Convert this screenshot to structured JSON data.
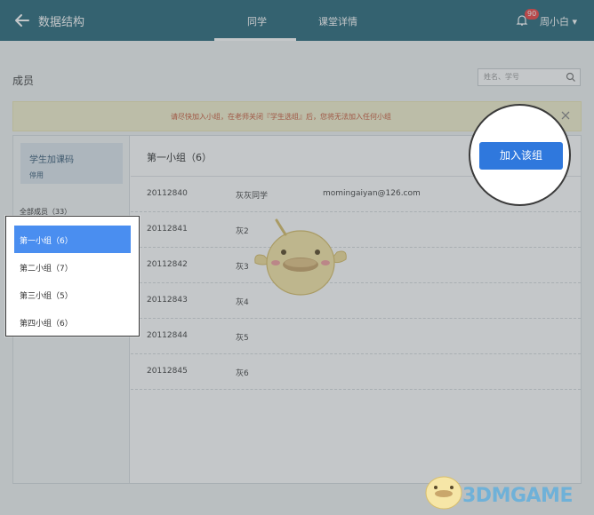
{
  "header": {
    "title": "数据结构",
    "tabs": [
      {
        "label": "同学",
        "active": true
      },
      {
        "label": "课堂详情",
        "active": false
      }
    ],
    "notification_count": "90",
    "username": "周小白 ▾"
  },
  "page": {
    "title": "成员",
    "search_placeholder": "姓名、学号"
  },
  "notice": {
    "text": "请尽快加入小组，在老师关闭『学生选组』后，您将无法加入任何小组"
  },
  "sidebar": {
    "code_label": "学生加课码",
    "code_status": "停用",
    "all_members": "全部成员（33）",
    "groups": [
      {
        "label": "第一小组（6）",
        "selected": true
      },
      {
        "label": "第二小组（7）",
        "selected": false
      },
      {
        "label": "第三小组（5）",
        "selected": false
      },
      {
        "label": "第四小组（6）",
        "selected": false
      }
    ]
  },
  "main": {
    "group_title": "第一小组（6）",
    "join_label": "加入该组",
    "members": [
      {
        "id": "20112840",
        "name": "灰灰同学",
        "email": "momingaiyan@126.com"
      },
      {
        "id": "20112841",
        "name": "灰2",
        "email": ""
      },
      {
        "id": "20112842",
        "name": "灰3",
        "email": ""
      },
      {
        "id": "20112843",
        "name": "灰4",
        "email": ""
      },
      {
        "id": "20112844",
        "name": "灰5",
        "email": ""
      },
      {
        "id": "20112845",
        "name": "灰6",
        "email": ""
      }
    ]
  },
  "watermark": "3DMGAME",
  "colors": {
    "header_bg": "#2b6a7d",
    "accent": "#2f78dd",
    "selected_group": "#4a8ef0",
    "notice_bg": "#f4f0cf",
    "notice_text": "#c95b3c"
  },
  "icons": [
    "back-arrow-icon",
    "bell-icon",
    "search-icon",
    "close-icon",
    "mascot-illustration"
  ]
}
